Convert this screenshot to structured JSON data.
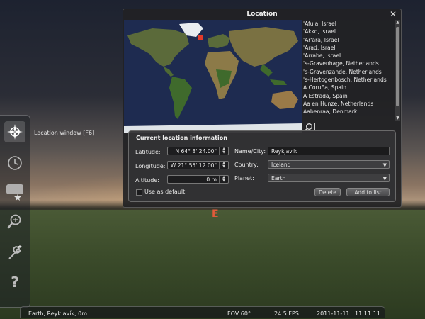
{
  "sky": {
    "compass_label": "E"
  },
  "toolbar": {
    "tooltip": "Location window  [F6]",
    "items": [
      {
        "icon": "location-compass-icon"
      },
      {
        "icon": "clock-icon"
      },
      {
        "icon": "sky-viewing-icon"
      },
      {
        "icon": "search-magnifier-icon"
      },
      {
        "icon": "wrench-settings-icon"
      },
      {
        "icon": "help-question-icon"
      }
    ]
  },
  "bottombar": {
    "location": "Earth, Reyk avík, 0m",
    "fov": "FOV 60°",
    "fps": "24.5 FPS",
    "date": "2011-11-11",
    "time": "11:11:11"
  },
  "window": {
    "title": "Location",
    "close": "✕",
    "cities": [
      "'Afula, Israel",
      "'Akko, Israel",
      "'Ar'ara, Israel",
      "'Arad, Israel",
      "'Arrabe, Israel",
      "'s-Gravenhage, Netherlands",
      "'s-Gravenzande, Netherlands",
      "'s-Hertogenbosch, Netherlands",
      "A Coruña, Spain",
      "A Estrada, Spain",
      "Aa en Hunze, Netherlands",
      "Aabenraa, Denmark"
    ],
    "search": {
      "value": ""
    },
    "panel": {
      "title": "Current location information",
      "latitude_label": "Latitude:",
      "latitude_value": "N 64° 8' 24.00\"",
      "longitude_label": "Longitude:",
      "longitude_value": "W 21° 55' 12.00\"",
      "altitude_label": "Altitude:",
      "altitude_value": "0 m",
      "use_default_label": "Use as default",
      "name_label": "Name/City:",
      "name_value": "Reykjavik",
      "country_label": "Country:",
      "country_value": "Iceland",
      "planet_label": "Planet:",
      "planet_value": "Earth",
      "delete_label": "Delete",
      "add_label": "Add to list"
    }
  },
  "colors": {
    "accent_red": "#e25a3a",
    "marker_red": "#e33a2a"
  }
}
